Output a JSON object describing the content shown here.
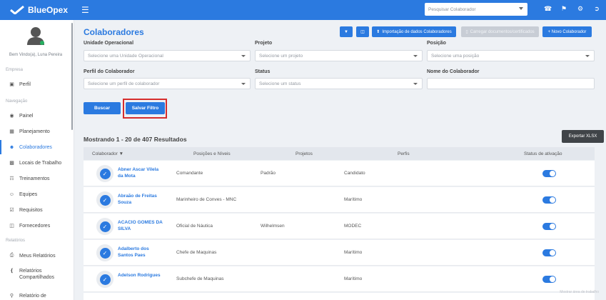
{
  "app": {
    "brand": "BlueOpex"
  },
  "topbar": {
    "search_placeholder": "Pesquisar Colaborador",
    "icons": [
      "headset-icon",
      "bell-icon",
      "gear-icon",
      "logout-icon"
    ]
  },
  "sidebar": {
    "welcome": "Bem Vindo(a), Luna Pereira",
    "sections": {
      "empresa": "Empresa",
      "navegacao": "Navegação",
      "relatorios": "Relatórios"
    },
    "items": [
      {
        "label": "Perfil",
        "icon": "briefcase-icon"
      },
      {
        "label": "Painel",
        "icon": "dashboard-icon"
      },
      {
        "label": "Planejamento",
        "icon": "calendar-icon"
      },
      {
        "label": "Colaboradores",
        "icon": "users-icon",
        "active": true
      },
      {
        "label": "Locais de Trabalho",
        "icon": "building-icon"
      },
      {
        "label": "Treinamentos",
        "icon": "training-icon"
      },
      {
        "label": "Equipes",
        "icon": "team-icon"
      },
      {
        "label": "Requisitos",
        "icon": "checkbox-icon"
      },
      {
        "label": "Fornecedores",
        "icon": "truck-icon"
      },
      {
        "label": "Meus Relatórios",
        "icon": "print-icon"
      },
      {
        "label": "Relatórios Compartilhados",
        "icon": "share-icon"
      },
      {
        "label": "Relatório de",
        "icon": "search-icon"
      }
    ]
  },
  "page": {
    "title": "Colaboradores",
    "buttons": {
      "import": "Importação de dados Colaboradores",
      "upload_docs": "Carregar documentos/certificados",
      "new": "+ Novo Colaborador",
      "search": "Buscar",
      "save_filter": "Salvar Filtro",
      "export": "Exportar XLSX"
    },
    "filters": {
      "unidade": {
        "label": "Unidade Operacional",
        "placeholder": "Selecione uma Unidade Operacional"
      },
      "projeto": {
        "label": "Projeto",
        "placeholder": "Selecione um projeto"
      },
      "posicao": {
        "label": "Posição",
        "placeholder": "Selecione uma posição"
      },
      "perfil": {
        "label": "Perfil do Colaborador",
        "placeholder": "Selecione um perfil de colaborador"
      },
      "status": {
        "label": "Status",
        "placeholder": "Selecione um status"
      },
      "nome": {
        "label": "Nome do Colaborador",
        "value": ""
      }
    },
    "results_text": "Mostrando 1 - 20 de 407 Resultados"
  },
  "table": {
    "headers": {
      "colaborador": "Colaborador",
      "posicoes": "Posições e Níveis",
      "projetos": "Projetos",
      "perfis": "Perfis",
      "status": "Status de ativação"
    },
    "rows": [
      {
        "name": "Abner Ascar Vilela da Mota",
        "posicao": "Comandante",
        "projeto": "Padrão",
        "perfil": "Candidato",
        "active": true
      },
      {
        "name": "Abraão de Freitas Souza",
        "posicao": "Marinheiro de Conves - MNC",
        "projeto": "",
        "perfil": "Marítimo",
        "active": true
      },
      {
        "name": "ACACIO GOMES DA SILVA",
        "posicao": "Oficial de Náutica",
        "projeto": "Wilhelmsen",
        "perfil": "MODEC",
        "active": true
      },
      {
        "name": "Adalberto dos Santos Paes",
        "posicao": "Chefe de Maquinas",
        "projeto": "",
        "perfil": "Marítimo",
        "active": true
      },
      {
        "name": "Adelson Rodrigues",
        "posicao": "Subchefe de Maquinas",
        "projeto": "",
        "perfil": "Marítimo",
        "active": true
      }
    ]
  },
  "watermark": "Mostrar área de trabalho"
}
